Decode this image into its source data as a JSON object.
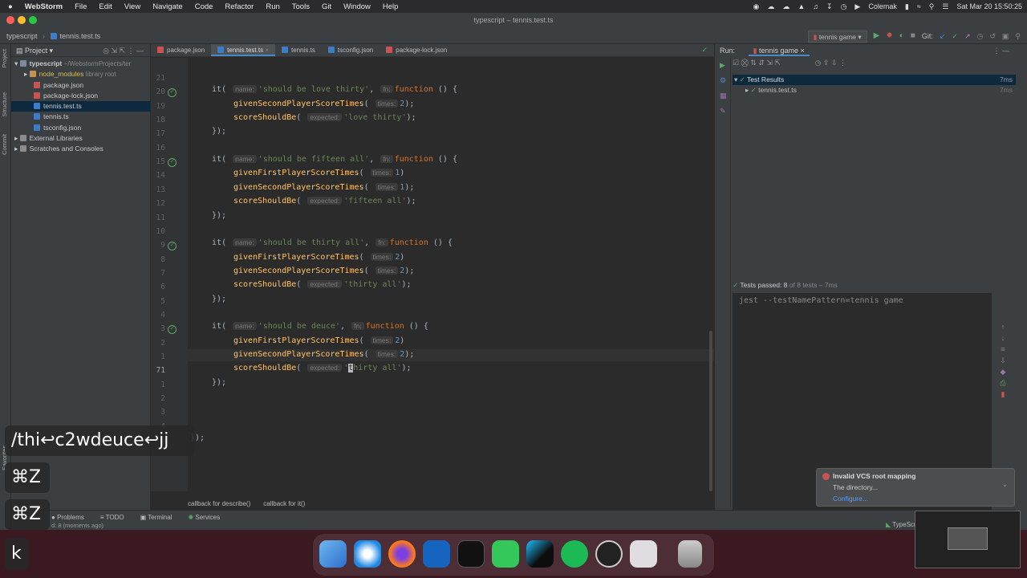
{
  "menubar": {
    "apple": "",
    "app": "WebStorm",
    "items": [
      "File",
      "Edit",
      "View",
      "Navigate",
      "Code",
      "Refactor",
      "Run",
      "Tools",
      "Git",
      "Window",
      "Help"
    ],
    "keyboard": "Colemak",
    "datetime": "Sat Mar 20  15:50:25"
  },
  "window": {
    "title": "typescript – tennis.test.ts"
  },
  "navbar": {
    "project": "typescript",
    "file": "tennis.test.ts",
    "run_config": "tennis game",
    "git_label": "Git:"
  },
  "project_panel": {
    "header": "Project",
    "tree": [
      {
        "label": "typescript",
        "suffix": "~/WebstormProjects/ter",
        "type": "folder"
      },
      {
        "label": "node_modules",
        "suffix": "library root",
        "type": "folder"
      },
      {
        "label": "package.json",
        "type": "json"
      },
      {
        "label": "package-lock.json",
        "type": "json"
      },
      {
        "label": "tennis.test.ts",
        "type": "ts"
      },
      {
        "label": "tennis.ts",
        "type": "ts"
      },
      {
        "label": "tsconfig.json",
        "type": "json"
      },
      {
        "label": "External Libraries",
        "type": "lib"
      },
      {
        "label": "Scratches and Consoles",
        "type": "scratch"
      }
    ],
    "side_labels": [
      "Project",
      "Structure",
      "Commit",
      "Favorites"
    ]
  },
  "tabs": [
    "package.json",
    "tennis.test.ts",
    "tennis.ts",
    "tsconfig.json",
    "package-lock.json"
  ],
  "editor": {
    "line_numbers": [
      "21",
      "20",
      "19",
      "18",
      "17",
      "16",
      "15",
      "14",
      "13",
      "12",
      "11",
      "10",
      "9",
      "8",
      "7",
      "6",
      "5",
      "4",
      "3",
      "2",
      "1",
      "71",
      "1",
      "2",
      "3",
      "4",
      "5"
    ],
    "hint_name": "name:",
    "hint_fn": "fn:",
    "hint_times": "times:",
    "hint_expected": "expected:",
    "kw_it": "it(",
    "kw_function": "function",
    "paren": "() {",
    "fn_second": "givenSecondPlayerScoreTimes",
    "fn_first": "givenFirstPlayerScoreTimes",
    "fn_should": "scoreShouldBe",
    "close": "});",
    "close_outer": "});",
    "tests": [
      {
        "name": "'should be love thirty'",
        "first": null,
        "second": "2",
        "expected": "'love thirty'"
      },
      {
        "name": "'should be fifteen all'",
        "first": "1",
        "second": "1",
        "expected": "'fifteen all'"
      },
      {
        "name": "'should be thirty all'",
        "first": "2",
        "second": "2",
        "expected": "'thirty all'"
      },
      {
        "name": "'should be deuce'",
        "first": "2",
        "second": "2",
        "expected": "'thirty all'"
      }
    ],
    "breadcrumb": [
      "callback for describe()",
      "callback for it()"
    ]
  },
  "run_panel": {
    "label": "Run:",
    "config": "tennis game",
    "results_root": "Test Results",
    "results_root_time": "7ms",
    "results_child": "tennis.test.ts",
    "results_child_time": "7ms",
    "tests_passed": "Tests passed: 8",
    "of_total": "of 8 tests – 7ms",
    "console": "jest --testNamePattern=tennis game"
  },
  "notification": {
    "title": "Invalid VCS root mapping",
    "body": "The directory...",
    "link": "Configure..."
  },
  "statusbar": {
    "problems": "Problems",
    "todo": "TODO",
    "terminal": "Terminal",
    "services": "Services",
    "message": "d: 8 (moments ago)",
    "lang": "TypeScript"
  },
  "keystroke_overlay": {
    "line1": "/thi↩c2wdeuce↩jj",
    "line2": "⌘Z",
    "line3": "⌘Z",
    "line4": "k"
  },
  "dock": {
    "apps": [
      "finder-icon",
      "safari-icon",
      "firefox-icon",
      "outlook-icon",
      "terminal-icon",
      "messages-icon",
      "webstorm-icon",
      "spotify-icon",
      "clock-icon",
      "keycastr-icon",
      "trash-icon"
    ]
  }
}
